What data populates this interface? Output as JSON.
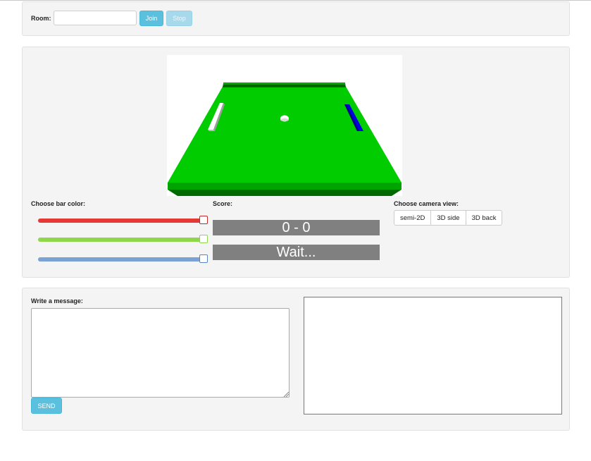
{
  "room": {
    "label": "Room:",
    "input_value": "",
    "join_label": "Join",
    "stop_label": "Stop"
  },
  "game": {
    "bar_color_label": "Choose bar color:",
    "score_label": "Score:",
    "camera_label": "Choose camera view:",
    "score": "0 - 0",
    "status": "Wait...",
    "color_sliders": [
      {
        "name": "red",
        "value": 1.0,
        "color": "#e53935"
      },
      {
        "name": "green",
        "value": 1.0,
        "color": "#8ed64a"
      },
      {
        "name": "blue",
        "value": 1.0,
        "color": "#7ba2d4"
      }
    ],
    "camera_views": [
      "semi-2D",
      "3D side",
      "3D back"
    ],
    "scene_colors": {
      "table": "#00cc00",
      "table_edge": "#007a00",
      "left_paddle": "#ffffff",
      "right_paddle": "#0000dd",
      "ball": "#ffffff"
    }
  },
  "chat": {
    "message_label": "Write a message:",
    "message_value": "",
    "send_label": "SEND"
  }
}
